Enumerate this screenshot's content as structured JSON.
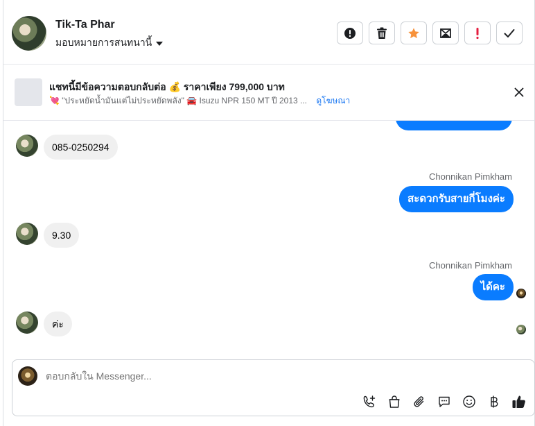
{
  "header": {
    "name": "Tik-Ta Phar",
    "assign_label": "มอบหมายการสนทนานี้",
    "actions": [
      "mark-spam",
      "delete",
      "star",
      "archive",
      "important",
      "done"
    ],
    "star_color": "#f7923b",
    "important_color": "#e41e3f"
  },
  "ad": {
    "title": "แชทนี้มีข้อความตอบกลับต่อ 💰 ราคาเพียง 799,000 บาท",
    "subtitle": "💘 \"ประหยัดน้ำมันแต่ไม่ประหยัดพลัง\" 🚘 Isuzu NPR 150 MT ปี 2013 ...",
    "link": "ดูโฆษณา"
  },
  "messages": {
    "m1": "085-0250294",
    "m2_sender": "Chonnikan Pimkham",
    "m2": "สะดวกรับสายกี่โมงค่ะ",
    "m3": "9.30",
    "m4_sender": "Chonnikan Pimkham",
    "m4": "ได้คะ",
    "m5": "ค่ะ"
  },
  "composer": {
    "placeholder": "ตอบกลับใน Messenger...",
    "icons": [
      "phone-add-icon",
      "shopping-bag-icon",
      "paperclip-icon",
      "quick-reply-icon",
      "emoji-icon",
      "baht-icon",
      "thumbs-up-icon"
    ]
  },
  "colors": {
    "accent": "#0a7cff",
    "link": "#1876f2"
  }
}
